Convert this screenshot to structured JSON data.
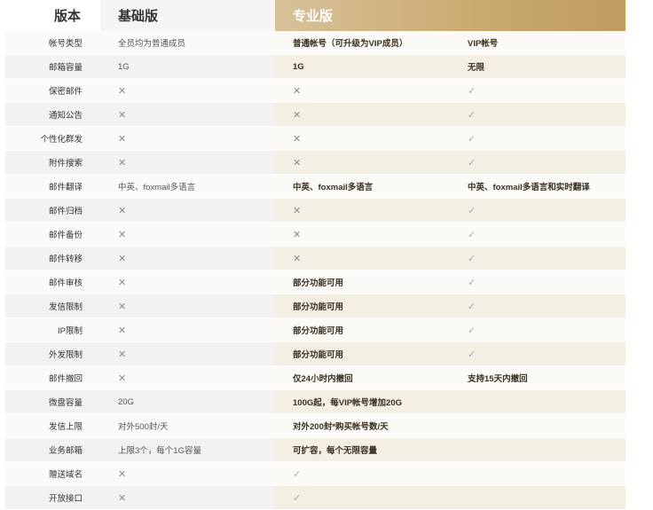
{
  "header": {
    "version": "版本",
    "basic": "基础版",
    "pro": "专业版"
  },
  "rows": [
    {
      "label": "帐号类型",
      "basic": "全员均为普通成员",
      "std": "普通帐号（可升级为VIP成员）",
      "vip": "VIP帐号"
    },
    {
      "label": "邮箱容量",
      "basic": "1G",
      "std": "1G",
      "vip": "无限"
    },
    {
      "label": "保密邮件",
      "basic": "✕",
      "std": "✕",
      "vip": "✓"
    },
    {
      "label": "通知公告",
      "basic": "✕",
      "std": "✕",
      "vip": "✓"
    },
    {
      "label": "个性化群发",
      "basic": "✕",
      "std": "✕",
      "vip": "✓"
    },
    {
      "label": "附件搜索",
      "basic": "✕",
      "std": "✕",
      "vip": "✓"
    },
    {
      "label": "邮件翻译",
      "basic": "中英、foxmail多语言",
      "std": "中英、foxmail多语言",
      "vip": "中英、foxmail多语言和实时翻译"
    },
    {
      "label": "邮件归档",
      "basic": "✕",
      "std": "✕",
      "vip": "✓"
    },
    {
      "label": "邮件备份",
      "basic": "✕",
      "std": "✕",
      "vip": "✓"
    },
    {
      "label": "邮件转移",
      "basic": "✕",
      "std": "✕",
      "vip": "✓"
    },
    {
      "label": "邮件审核",
      "basic": "✕",
      "std": "部分功能可用",
      "vip": "✓"
    },
    {
      "label": "发信限制",
      "basic": "✕",
      "std": "部分功能可用",
      "vip": "✓"
    },
    {
      "label": "IP限制",
      "basic": "✕",
      "std": "部分功能可用",
      "vip": "✓"
    },
    {
      "label": "外发限制",
      "basic": "✕",
      "std": "部分功能可用",
      "vip": "✓"
    },
    {
      "label": "邮件撤回",
      "basic": "✕",
      "std": "仅24小时内撤回",
      "vip": "支持15天内撤回"
    },
    {
      "label": "微盘容量",
      "basic": "20G",
      "merged": "100G起，每VIP帐号增加20G"
    },
    {
      "label": "发信上限",
      "basic": "对外500封/天",
      "merged": "对外200封*购买帐号数/天"
    },
    {
      "label": "业务邮箱",
      "basic": "上限3个，每个1G容量",
      "merged": "可扩容，每个无限容量"
    },
    {
      "label": "赠送域名",
      "basic": "✕",
      "merged": "✓"
    },
    {
      "label": "开放接口",
      "basic": "✕",
      "merged": "✓"
    }
  ]
}
